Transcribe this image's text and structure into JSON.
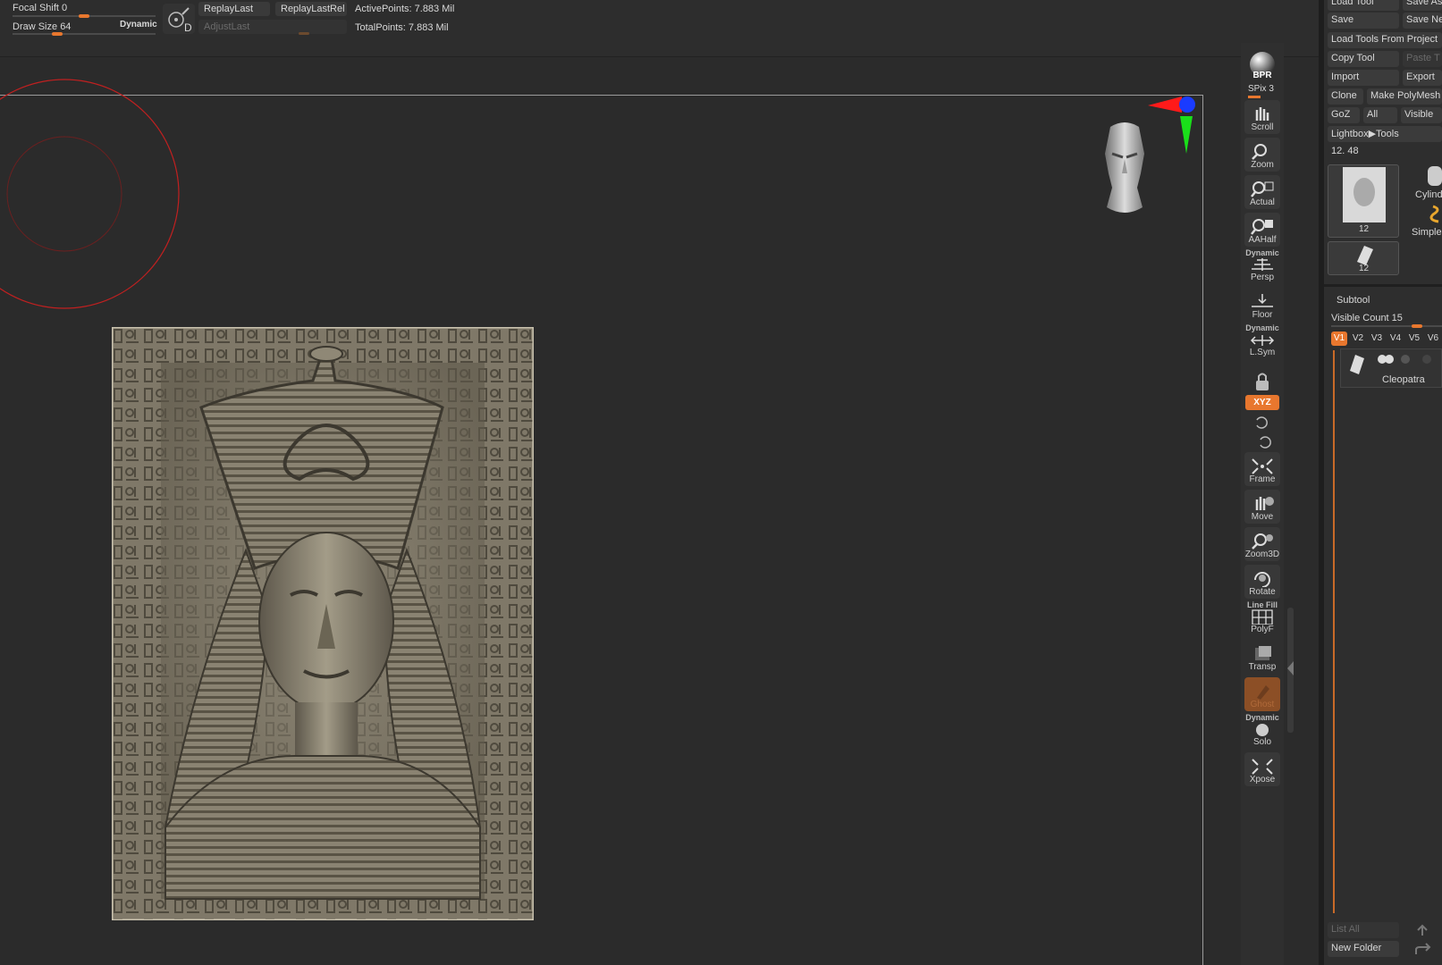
{
  "topbar": {
    "focal_shift_label": "Focal Shift",
    "focal_shift_value": "0",
    "focal_shift_level": 0.5,
    "draw_size_label": "Draw Size",
    "draw_size_value": "64",
    "draw_size_level": 0.3,
    "dynamic_label": "Dynamic",
    "d_label": "D",
    "replay_last": "ReplayLast",
    "replay_last_rel": "ReplayLastRel",
    "adjust_last": "AdjustLast",
    "active_points": "ActivePoints: 7.883 Mil",
    "total_points": "TotalPoints: 7.883 Mil"
  },
  "shelf": {
    "bpr": "BPR",
    "spix": "SPix 3",
    "scroll": "Scroll",
    "zoom": "Zoom",
    "actual": "Actual",
    "aahalf": "AAHalf",
    "persp_top": "Dynamic",
    "persp": "Persp",
    "floor": "Floor",
    "lsym_top": "Dynamic",
    "lsym": "L.Sym",
    "xyz": "XYZ",
    "frame": "Frame",
    "move": "Move",
    "zoom3d": "Zoom3D",
    "rotate": "Rotate",
    "polyf_top": "Line Fill",
    "polyf": "PolyF",
    "transp": "Transp",
    "ghost": "Ghost",
    "solo_top": "Dynamic",
    "solo": "Solo",
    "xpose": "Xpose"
  },
  "panel": {
    "load_tool": "Load Tool",
    "save_as": "Save As",
    "save": "Save",
    "save_next": "Save Ne",
    "load_from_project": "Load Tools From Project",
    "copy_tool": "Copy Tool",
    "paste_tool": "Paste T",
    "import": "Import",
    "export": "Export",
    "clone": "Clone",
    "make_polymesh": "Make PolyMesh",
    "goz": "GoZ",
    "all": "All",
    "visible": "Visible",
    "lightbox_tools": "Lightbox▶Tools",
    "tool_value": "12. 48",
    "thumb1_num": "12",
    "thumb2_num": "12",
    "cylinder": "Cylind",
    "simple": "Simple",
    "subtool_title": "Subtool",
    "visible_count": "Visible Count 15",
    "visible_count_level": 0.8,
    "vtabs": [
      "V1",
      "V2",
      "V3",
      "V4",
      "V5",
      "V6"
    ],
    "subtool_name": "Cleopatra",
    "list_all": "List All",
    "new_folder": "New Folder"
  },
  "colors": {
    "accent": "#e8772e",
    "brush_ring": "#c02020",
    "axis_x": "#ff1a1a",
    "axis_y": "#1adf1a",
    "axis_z": "#1a3bff"
  }
}
